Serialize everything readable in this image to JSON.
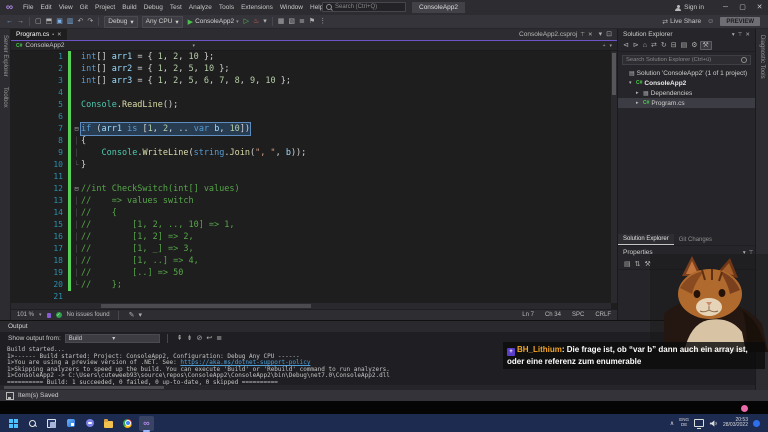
{
  "glyphs": {
    "close": "✕",
    "pin": "⊤",
    "caret": "▾",
    "minimize": "─",
    "maximize": "▢",
    "dot": "•",
    "play": "▶",
    "check": "✓",
    "chevron_up": "∧",
    "plus": "+",
    "smiley": "☺",
    "share": "⇄",
    "infinity": "∞"
  },
  "titlebar": {
    "menus": [
      "File",
      "Edit",
      "View",
      "Git",
      "Project",
      "Build",
      "Debug",
      "Test",
      "Analyze",
      "Tools",
      "Extensions",
      "Window",
      "Help"
    ],
    "search_placeholder": "Search (Ctrl+Q)",
    "window_title": "ConsoleApp2",
    "sign_in": "Sign in"
  },
  "toolbar": {
    "nav_icons": [
      {
        "n": "navigate-backward-icon",
        "g": "←",
        "c": "#7fb2e8"
      },
      {
        "n": "navigate-forward-icon",
        "g": "→"
      }
    ],
    "file_icons": [
      {
        "n": "new-project-icon",
        "g": "▢"
      },
      {
        "n": "open-file-icon",
        "g": "⬒"
      },
      {
        "n": "save-icon",
        "g": "▣",
        "c": "#7fb2e8"
      },
      {
        "n": "save-all-icon",
        "g": "▥",
        "c": "#7fb2e8"
      },
      {
        "n": "undo-icon",
        "g": "↶"
      },
      {
        "n": "redo-icon",
        "g": "↷"
      }
    ],
    "configuration": "Debug",
    "platform": "Any CPU",
    "run_target": "ConsoleApp2",
    "run_extra_icons": [
      {
        "n": "run-without-debug-icon",
        "g": "▷",
        "c": "#57c057"
      },
      {
        "n": "hot-reload-icon",
        "g": "♨",
        "c": "#e0654f"
      },
      {
        "n": "chevron-down-icon",
        "g": "▾"
      }
    ],
    "end_icons": [
      {
        "n": "solution-platforms-icon",
        "g": "▦"
      },
      {
        "n": "find-in-files-icon",
        "g": "▧"
      },
      {
        "n": "command-window-icon",
        "g": "≣"
      },
      {
        "n": "bookmark-icon",
        "g": "⚑"
      },
      {
        "n": "more-options-icon",
        "g": "⋮"
      }
    ],
    "live_share": "Live Share",
    "preview_label": "PREVIEW"
  },
  "left_strip": {
    "tabs": [
      "Server Explorer",
      "Toolbox"
    ]
  },
  "editor": {
    "active_tab": "Program.cs",
    "secondary_tab": "ConsoleApp2.csproj",
    "tabrow_icons": [
      {
        "n": "tab-list-icon",
        "g": "▾"
      },
      {
        "n": "float-tab-icon",
        "g": "⊡"
      }
    ],
    "breadcrumb": "ConsoleApp2",
    "lines": [
      {
        "n": 1,
        "g": "",
        "t": [
          [
            "k",
            "int"
          ],
          [
            "p",
            "[] "
          ],
          [
            "i",
            "arr1"
          ],
          [
            "p",
            " = { "
          ],
          [
            "n",
            "1"
          ],
          [
            "p",
            ", "
          ],
          [
            "n",
            "2"
          ],
          [
            "p",
            ", "
          ],
          [
            "n",
            "10"
          ],
          [
            "p",
            " };"
          ]
        ]
      },
      {
        "n": 2,
        "g": "",
        "t": [
          [
            "k",
            "int"
          ],
          [
            "p",
            "[] "
          ],
          [
            "i",
            "arr2"
          ],
          [
            "p",
            " = { "
          ],
          [
            "n",
            "1"
          ],
          [
            "p",
            ", "
          ],
          [
            "n",
            "2"
          ],
          [
            "p",
            ", "
          ],
          [
            "n",
            "5"
          ],
          [
            "p",
            ", "
          ],
          [
            "n",
            "10"
          ],
          [
            "p",
            " };"
          ]
        ]
      },
      {
        "n": 3,
        "g": "",
        "t": [
          [
            "k",
            "int"
          ],
          [
            "p",
            "[] "
          ],
          [
            "i",
            "arr3"
          ],
          [
            "p",
            " = { "
          ],
          [
            "n",
            "1"
          ],
          [
            "p",
            ", "
          ],
          [
            "n",
            "2"
          ],
          [
            "p",
            ", "
          ],
          [
            "n",
            "5"
          ],
          [
            "p",
            ", "
          ],
          [
            "n",
            "6"
          ],
          [
            "p",
            ", "
          ],
          [
            "n",
            "7"
          ],
          [
            "p",
            ", "
          ],
          [
            "n",
            "8"
          ],
          [
            "p",
            ", "
          ],
          [
            "n",
            "9"
          ],
          [
            "p",
            ", "
          ],
          [
            "n",
            "10"
          ],
          [
            "p",
            " };"
          ]
        ]
      },
      {
        "n": 4,
        "g": "",
        "t": []
      },
      {
        "n": 5,
        "g": "",
        "t": [
          [
            "t",
            "Console"
          ],
          [
            "p",
            "."
          ],
          [
            "m",
            "ReadLine"
          ],
          [
            "p",
            "();"
          ]
        ]
      },
      {
        "n": 6,
        "g": "",
        "t": []
      },
      {
        "n": 7,
        "g": "⊟",
        "sel": true,
        "t": [
          [
            "k",
            "if"
          ],
          [
            "p",
            " ("
          ],
          [
            "i",
            "arr1"
          ],
          [
            "p",
            " "
          ],
          [
            "k",
            "is"
          ],
          [
            "p",
            " ["
          ],
          [
            "n",
            "1"
          ],
          [
            "p",
            ", "
          ],
          [
            "n",
            "2"
          ],
          [
            "p",
            ", .. "
          ],
          [
            "k",
            "var"
          ],
          [
            "p",
            " "
          ],
          [
            "i",
            "b"
          ],
          [
            "p",
            ", "
          ],
          [
            "n",
            "10"
          ],
          [
            "p",
            "])"
          ]
        ]
      },
      {
        "n": 8,
        "g": "│",
        "t": [
          [
            "p",
            "{"
          ]
        ]
      },
      {
        "n": 9,
        "g": "│",
        "t": [
          [
            "p",
            "    "
          ],
          [
            "t",
            "Console"
          ],
          [
            "p",
            "."
          ],
          [
            "m",
            "WriteLine"
          ],
          [
            "p",
            "("
          ],
          [
            "k",
            "string"
          ],
          [
            "p",
            "."
          ],
          [
            "m",
            "Join"
          ],
          [
            "p",
            "("
          ],
          [
            "s",
            "\", \""
          ],
          [
            "p",
            ", "
          ],
          [
            "i",
            "b"
          ],
          [
            "p",
            "));"
          ]
        ]
      },
      {
        "n": 10,
        "g": "└",
        "t": [
          [
            "p",
            "}"
          ]
        ]
      },
      {
        "n": 11,
        "g": "",
        "t": []
      },
      {
        "n": 12,
        "g": "⊟",
        "t": [
          [
            "c",
            "//int CheckSwitch(int[] values)"
          ]
        ]
      },
      {
        "n": 13,
        "g": "│",
        "t": [
          [
            "c",
            "//    => values switch"
          ]
        ]
      },
      {
        "n": 14,
        "g": "│",
        "t": [
          [
            "c",
            "//    {"
          ]
        ]
      },
      {
        "n": 15,
        "g": "│",
        "t": [
          [
            "c",
            "//        [1, 2, .., 10] => 1,"
          ]
        ]
      },
      {
        "n": 16,
        "g": "│",
        "t": [
          [
            "c",
            "//        [1, 2] => 2,"
          ]
        ]
      },
      {
        "n": 17,
        "g": "│",
        "t": [
          [
            "c",
            "//        [1, _] => 3,"
          ]
        ]
      },
      {
        "n": 18,
        "g": "│",
        "t": [
          [
            "c",
            "//        [1, ..] => 4,"
          ]
        ]
      },
      {
        "n": 19,
        "g": "│",
        "t": [
          [
            "c",
            "//        [..] => 50"
          ]
        ]
      },
      {
        "n": 20,
        "g": "└",
        "t": [
          [
            "c",
            "//    };"
          ]
        ]
      },
      {
        "n": 21,
        "g": "",
        "t": []
      }
    ],
    "status": {
      "zoom": "101 %",
      "health": "No issues found",
      "ln": "Ln 7",
      "ch": "Ch 34",
      "spc": "SPC",
      "eol": "CRLF"
    },
    "status_icons": [
      {
        "n": "pencil-icon",
        "g": "✎"
      },
      {
        "n": "chevron-down-icon",
        "g": "▾"
      }
    ]
  },
  "solution_explorer": {
    "title": "Solution Explorer",
    "search_placeholder": "Search Solution Explorer (Ctrl+ü)",
    "toolbar_icons": [
      {
        "n": "navigate-back-icon",
        "g": "⊲"
      },
      {
        "n": "navigate-forward-icon",
        "g": "⊳"
      },
      {
        "n": "home-icon",
        "g": "⌂"
      },
      {
        "n": "switch-views-icon",
        "g": "⇄"
      },
      {
        "n": "refresh-icon",
        "g": "↻"
      },
      {
        "n": "collapse-all-icon",
        "g": "⊟"
      },
      {
        "n": "show-all-files-icon",
        "g": "▤"
      },
      {
        "n": "properties-icon",
        "g": "⚙"
      },
      {
        "n": "wrench-icon",
        "g": "⚒",
        "b": 1
      }
    ],
    "tree": [
      {
        "label": "Solution 'ConsoleApp2' (1 of 1 project)",
        "icon": "solution-icon",
        "icon_text": "▤",
        "indent": 0,
        "arrow": ""
      },
      {
        "label": "ConsoleApp2",
        "icon": "csharp-project-icon",
        "icon_text": "C#",
        "indent": 1,
        "arrow": "▾",
        "bold": true
      },
      {
        "label": "Dependencies",
        "icon": "dependencies-icon",
        "icon_text": "▦",
        "indent": 2,
        "arrow": "▸"
      },
      {
        "label": "Program.cs",
        "icon": "csharp-file-icon",
        "icon_text": "C#",
        "indent": 2,
        "arrow": "▸",
        "selected": true
      }
    ]
  },
  "panel_tabs": [
    "Solution Explorer",
    "Git Changes"
  ],
  "properties": {
    "title": "Properties",
    "toolbar_icons": [
      {
        "n": "categorized-icon",
        "g": "▤"
      },
      {
        "n": "alphabetical-sort-icon",
        "g": "⇅"
      },
      {
        "n": "property-pages-icon",
        "g": "⚒"
      }
    ]
  },
  "right_strip": {
    "tab": "Diagnostic Tools"
  },
  "output": {
    "title": "Output",
    "show_from_label": "Show output from:",
    "source": "Build",
    "toolbar_icons": [
      {
        "n": "previous-message-icon",
        "g": "⇞"
      },
      {
        "n": "next-message-icon",
        "g": "⇟"
      },
      {
        "n": "clear-all-icon",
        "g": "⊘"
      },
      {
        "n": "word-wrap-icon",
        "g": "↩"
      },
      {
        "n": "messages-list-icon",
        "g": "≣"
      }
    ],
    "lines": [
      [
        [
          "pl",
          "Build started..."
        ]
      ],
      [
        [
          "pl",
          "1>------ Build started: Project: ConsoleApp2, Configuration: Debug Any CPU ------"
        ]
      ],
      [
        [
          "pl",
          "1>You are using a preview version of .NET. See: "
        ],
        [
          "lk",
          "https://aka.ms/dotnet-support-policy"
        ]
      ],
      [
        [
          "pl",
          "1>Skipping analyzers to speed up the build. You can execute 'Build' or 'Rebuild' command to run analyzers."
        ]
      ],
      [
        [
          "pl",
          "1>ConsoleApp2 -> C:\\Users\\cuteweeb93\\source\\repos\\ConsoleApp2\\ConsoleApp2\\bin\\Debug\\net7.0\\ConsoleApp2.dll"
        ]
      ],
      [
        [
          "pl",
          "========== Build: 1 succeeded, 0 failed, 0 up-to-date, 0 skipped =========="
        ]
      ]
    ]
  },
  "status_bar": {
    "message": "Item(s) Saved"
  },
  "chat": {
    "badge": "+",
    "username": "BH_Lithium",
    "separator": ": ",
    "message": "Die frage ist, ob “var b” dann auch ein array ist, oder eine referenz zum enumerable"
  },
  "taskbar": {
    "lang_top": "ENG",
    "lang_bottom": "DE",
    "time": "20:53",
    "date": "28/03/2022",
    "chevron": "∧"
  }
}
